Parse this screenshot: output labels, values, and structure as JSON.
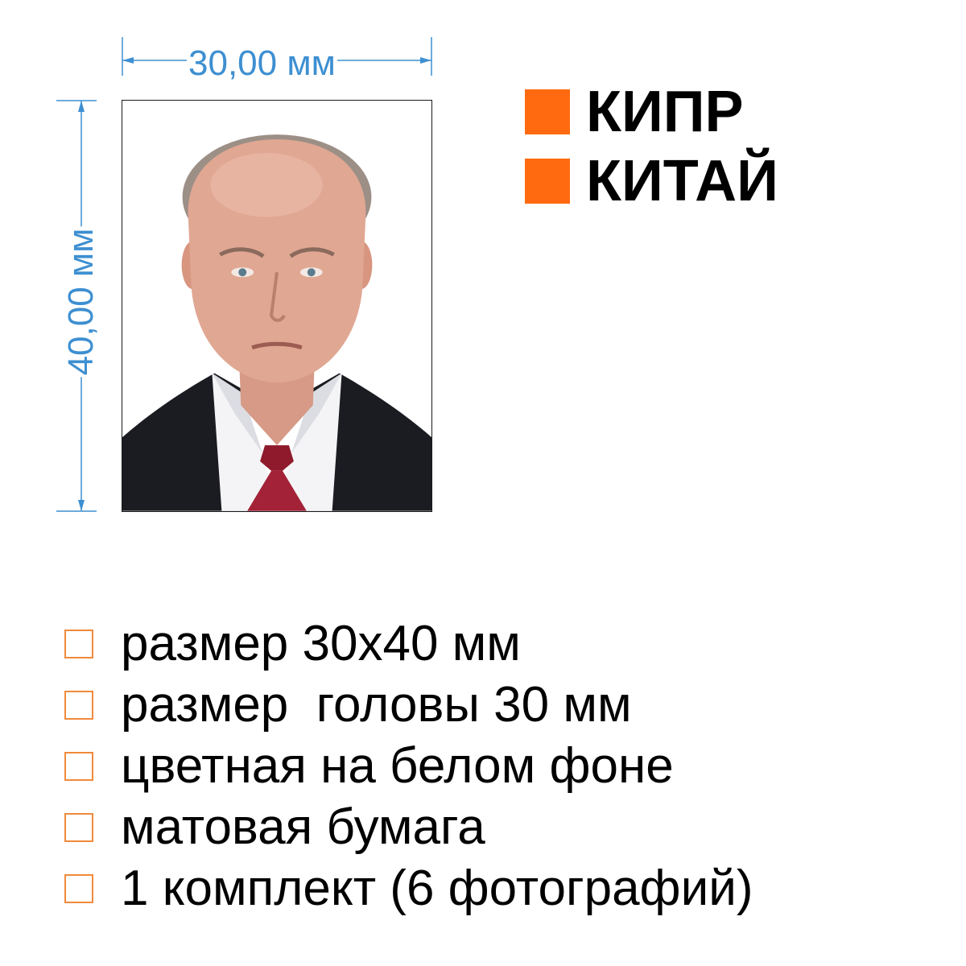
{
  "dimensions": {
    "width_label": "30,00 мм",
    "height_label": "40,00 мм"
  },
  "colors": {
    "dimension": "#3d8fd1",
    "accent": "#ff6a10",
    "checkbox_border": "#f08a3c"
  },
  "countries": [
    {
      "name": "КИПР"
    },
    {
      "name": "КИТАЙ"
    }
  ],
  "features": [
    {
      "text": "размер 30х40 мм"
    },
    {
      "text": "размер  головы 30 мм"
    },
    {
      "text": "цветная на белом фоне"
    },
    {
      "text": "матовая бумага"
    },
    {
      "text": "1 комплект (6 фотографий)"
    }
  ]
}
